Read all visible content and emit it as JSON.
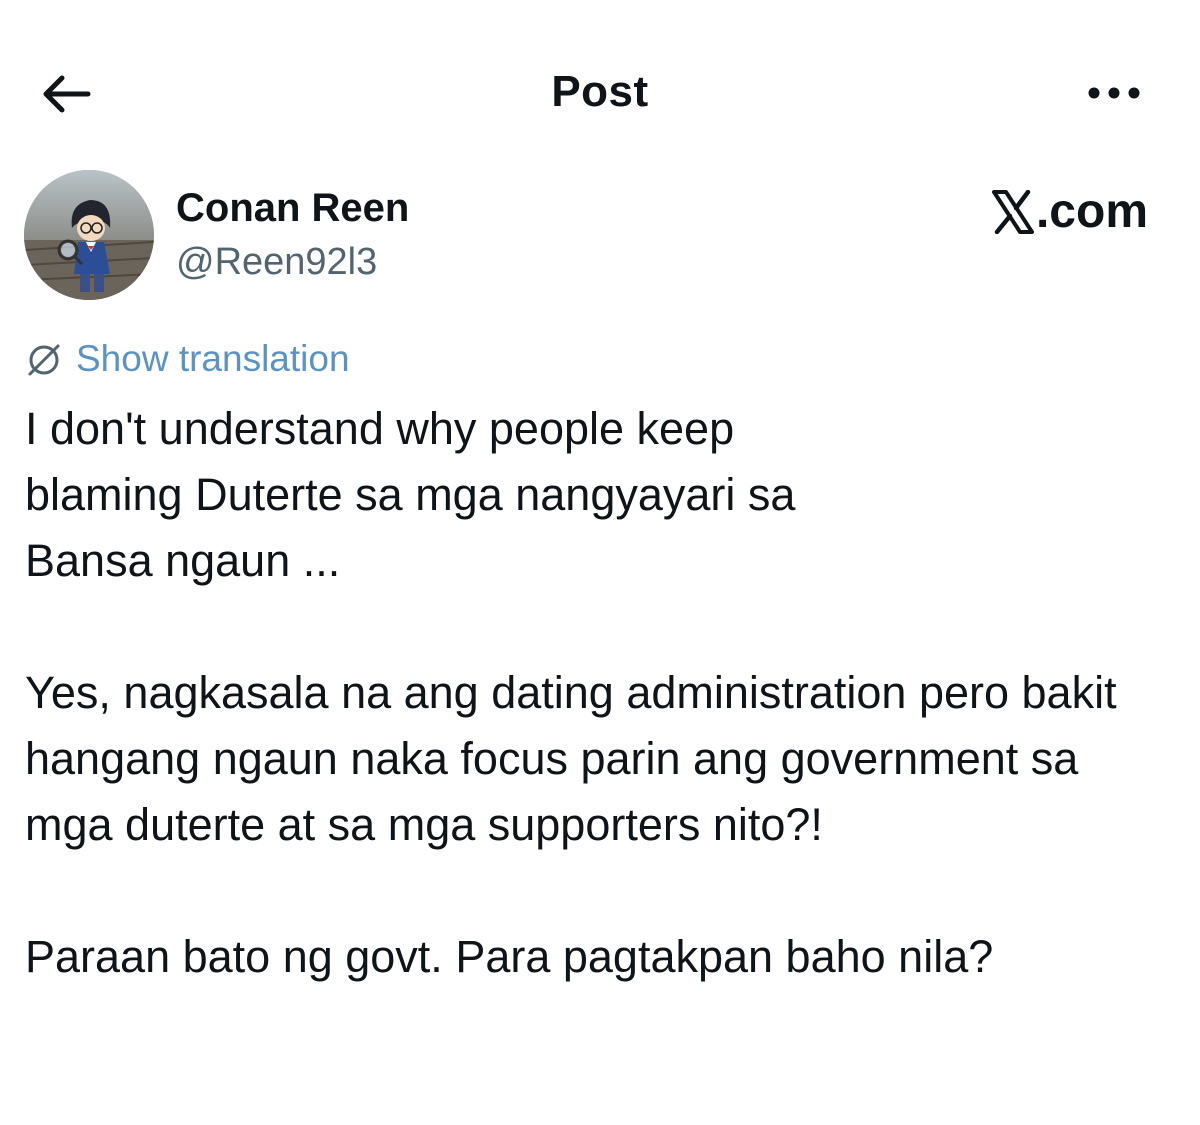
{
  "header": {
    "title": "Post",
    "back_icon": "arrow-left-icon",
    "more_icon": "more-horizontal-icon"
  },
  "author": {
    "display_name": "Conan Reen",
    "handle": "@Reen92l3",
    "avatar_icon": "avatar-anime-detective"
  },
  "brand": {
    "label": ".com",
    "logo_icon": "x-logo-icon"
  },
  "translation": {
    "label": "Show translation",
    "icon": "translate-globe-icon",
    "color": "#5b93c4"
  },
  "post": {
    "paragraphs": [
      "I don't understand why people keep blaming Duterte sa mga nangyayari sa Bansa ngaun ...",
      "Yes, nagkasala na ang dating administration pero bakit hangang ngaun naka focus parin ang government sa mga duterte at sa mga supporters nito?!",
      "Paraan bato ng govt. Para pagtakpan baho nila?"
    ]
  },
  "colors": {
    "text": "#0f1419",
    "secondary_text": "#536471",
    "background": "#ffffff"
  }
}
